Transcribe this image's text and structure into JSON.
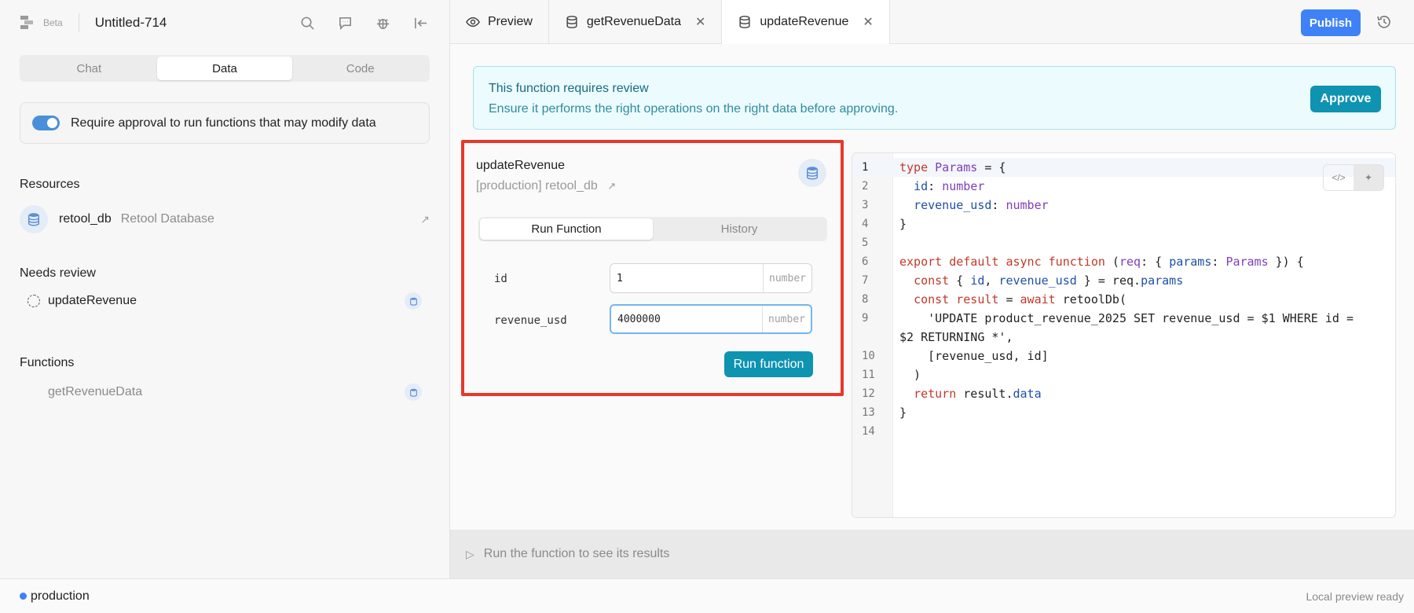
{
  "sidebar": {
    "beta": "Beta",
    "app_title": "Untitled-714",
    "tabs": [
      "Chat",
      "Data",
      "Code"
    ],
    "active_tab": "Data",
    "approval_toggle": {
      "label": "Require approval to run functions that may modify data",
      "on": true
    },
    "resources_title": "Resources",
    "resources": [
      {
        "name": "retool_db",
        "type": "Retool Database"
      }
    ],
    "needs_review_title": "Needs review",
    "needs_review": [
      {
        "name": "updateRevenue"
      }
    ],
    "functions_title": "Functions",
    "functions": [
      {
        "name": "getRevenueData"
      }
    ]
  },
  "tabbar": {
    "tabs": [
      {
        "label": "Preview",
        "icon": "eye-icon"
      },
      {
        "label": "getRevenueData",
        "icon": "database-icon"
      },
      {
        "label": "updateRevenue",
        "icon": "database-icon"
      }
    ],
    "publish_label": "Publish"
  },
  "banner": {
    "title": "This function requires review",
    "subtitle": "Ensure it performs the right operations on the right data before approving.",
    "approve_label": "Approve"
  },
  "function": {
    "name": "updateRevenue",
    "env": "[production] retool_db",
    "tabs": [
      "Run Function",
      "History"
    ],
    "params": [
      {
        "name": "id",
        "value": "1",
        "type": "number"
      },
      {
        "name": "revenue_usd",
        "value": "4000000",
        "type": "number"
      }
    ],
    "run_label": "Run function"
  },
  "code": {
    "line_numbers": [
      "1",
      "2",
      "3",
      "4",
      "5",
      "6",
      "7",
      "8",
      "9",
      "",
      "10",
      "11",
      "12",
      "13",
      "14"
    ]
  },
  "results": {
    "placeholder": "Run the function to see its results"
  },
  "footer": {
    "env": "production",
    "status": "Local preview ready"
  },
  "colors": {
    "accent": "#0e93b1",
    "publish": "#3f82f7",
    "highlight_border": "#e8382a"
  }
}
